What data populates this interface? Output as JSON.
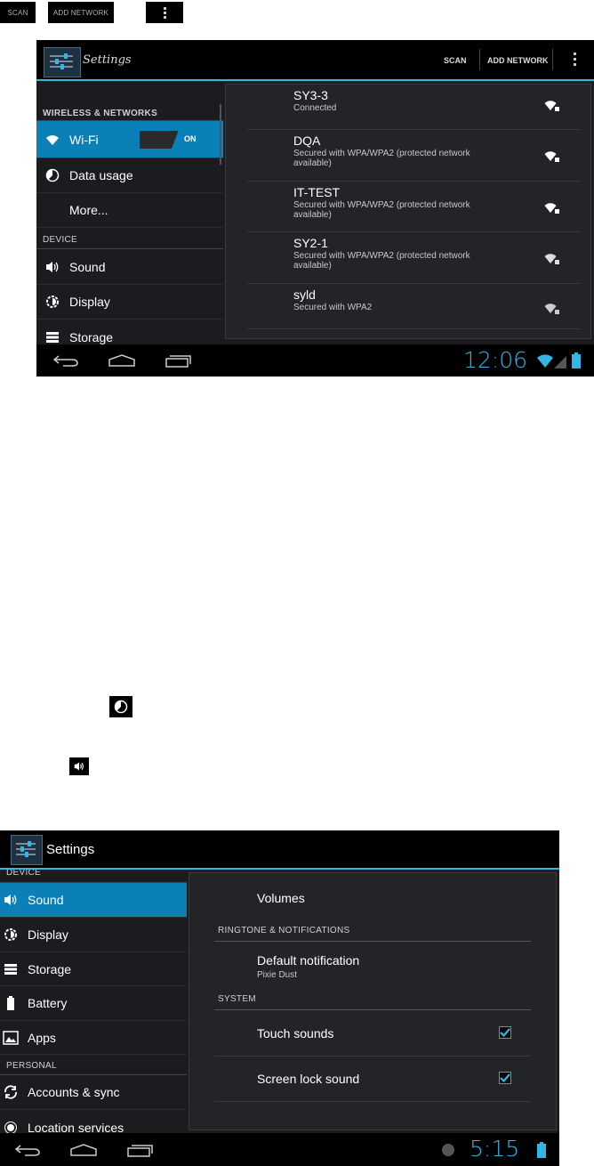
{
  "top_controls": {
    "scan": "SCAN",
    "add_network": "ADD NETWORK"
  },
  "shot1": {
    "title": "Settings",
    "actions": {
      "scan": "SCAN",
      "add_network": "ADD NETWORK"
    },
    "categories": {
      "wireless": "WIRELESS & NETWORKS",
      "device": "DEVICE"
    },
    "items": {
      "wifi": "Wi-Fi",
      "wifi_toggle": "ON",
      "data_usage": "Data usage",
      "more": "More...",
      "sound": "Sound",
      "display": "Display",
      "storage": "Storage"
    },
    "networks": [
      {
        "name": "SY3-3",
        "status": "Connected"
      },
      {
        "name": "DQA",
        "status": "Secured with WPA/WPA2 (protected network available)"
      },
      {
        "name": "IT-TEST",
        "status": "Secured with WPA/WPA2 (protected network available)"
      },
      {
        "name": "SY2-1",
        "status": "Secured with WPA/WPA2 (protected network available)"
      },
      {
        "name": "syld",
        "status": "Secured with WPA2"
      }
    ],
    "clock": "12:06"
  },
  "shot2": {
    "title": "Settings",
    "categories": {
      "device": "DEVICE",
      "personal": "PERSONAL"
    },
    "items": {
      "sound": "Sound",
      "display": "Display",
      "storage": "Storage",
      "battery": "Battery",
      "apps": "Apps",
      "accounts": "Accounts & sync",
      "location": "Location services"
    },
    "main": {
      "volumes": "Volumes",
      "ringtone_header": "RINGTONE & NOTIFICATIONS",
      "default_notification": "Default notification",
      "default_notification_value": "Pixie Dust",
      "system_header": "SYSTEM",
      "touch_sounds": "Touch sounds",
      "screen_lock_sound": "Screen lock sound",
      "touch_sounds_checked": true,
      "screen_lock_checked": true
    },
    "clock": "5:15"
  },
  "colors": {
    "accent": "#33b5e5",
    "selected": "#0b80b6",
    "panel": "#1b1c1f"
  }
}
